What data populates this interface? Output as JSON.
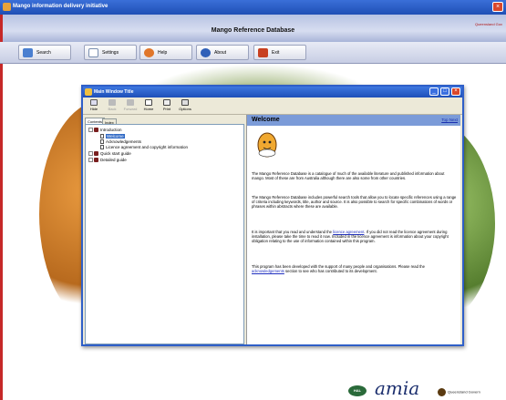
{
  "app": {
    "window_title": "Mango information delivery initiative",
    "title": "Mango Reference Database",
    "owner_text": "Queensland Gov"
  },
  "toolbar": {
    "buttons": [
      {
        "label": "Search",
        "icon": "search-icon",
        "color": "#4a7fd0"
      },
      {
        "label": "Settings",
        "icon": "settings-icon",
        "color": "#7a8fb0"
      },
      {
        "label": "Help",
        "icon": "help-icon",
        "color": "#e0762a"
      },
      {
        "label": "About",
        "icon": "about-icon",
        "color": "#3060b8"
      },
      {
        "label": "Exit",
        "icon": "exit-icon",
        "color": "#c84020"
      }
    ]
  },
  "help_window": {
    "title": "Main Window Title",
    "tools": [
      {
        "label": "Hide",
        "enabled": true
      },
      {
        "label": "Back",
        "enabled": false
      },
      {
        "label": "Forward",
        "enabled": false
      },
      {
        "label": "Home",
        "enabled": true
      },
      {
        "label": "Print",
        "enabled": true
      },
      {
        "label": "Options",
        "enabled": true
      }
    ],
    "tabs": [
      "Contents",
      "Index"
    ],
    "tree": {
      "introduction": "Introduction",
      "welcome": "Welcome",
      "acknowledgements": "Acknowledgements",
      "licence": "Licence agreement and copyright information",
      "quick_start": "Quick start guide",
      "detailed": "Detailed guide"
    },
    "content": {
      "heading": "Welcome",
      "nav_prev": "Top",
      "nav_next": "Next",
      "p1": "The Mango Reference Database is a catalogue of much of the available literature and published information about mango.  Most of these are from Australia although there are also some from other countries.",
      "p2": "The Mango Reference Database includes powerful search tools that allow you to locate specific references using a range of criteria including keywords, title, author and source.  It is also possible to search for specific combinations of words or phrases within abstracts where these are available.",
      "p3_a": "It is important that you read and understand the ",
      "p3_link": "licence agreement",
      "p3_b": ".  If you did not read the licence agreement during installation, please take the time to read it now. Included in the licence agreement is information about your copyright obligation relating to the use of information contained within this program.",
      "p4_a": "This program has been developed with the support of many people and organisations. Please read the ",
      "p4_link": "acknowledgements",
      "p4_b": " section to see who has contributed to its development."
    }
  },
  "footer": {
    "hal": "HAL",
    "amia": "amia",
    "qld": "Queensland Govern"
  }
}
